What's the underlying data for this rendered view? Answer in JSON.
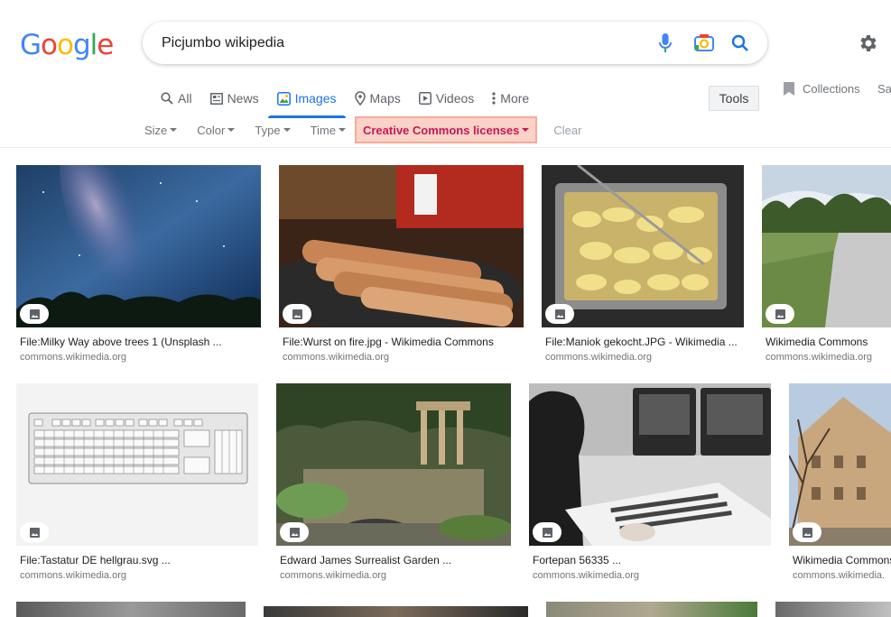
{
  "logo": [
    "G",
    "o",
    "o",
    "g",
    "l",
    "e"
  ],
  "logo_colors": [
    "#4285f4",
    "#ea4335",
    "#fbbc05",
    "#4285f4",
    "#34a853",
    "#ea4335"
  ],
  "search": {
    "query": "Picjumbo wikipedia"
  },
  "tabs": [
    {
      "label": "All",
      "icon": "search-icon"
    },
    {
      "label": "News",
      "icon": "news-icon"
    },
    {
      "label": "Images",
      "icon": "images-icon",
      "active": true
    },
    {
      "label": "Maps",
      "icon": "map-pin-icon"
    },
    {
      "label": "Videos",
      "icon": "video-icon"
    },
    {
      "label": "More",
      "icon": "more-vertical-icon"
    }
  ],
  "tools": "Tools",
  "collections": "Collections",
  "saved": "Sa",
  "filters": [
    "Size",
    "Color",
    "Type",
    "Time"
  ],
  "license_filter": "Creative Commons licenses",
  "clear": "Clear",
  "results": [
    {
      "caption": "File:Milky Way above trees 1 (Unsplash ...",
      "source": "commons.wikimedia.org"
    },
    {
      "caption": "File:Wurst on fire.jpg - Wikimedia Commons",
      "source": "commons.wikimedia.org"
    },
    {
      "caption": "File:Maniok gekocht.JPG - Wikimedia ...",
      "source": "commons.wikimedia.org"
    },
    {
      "caption": "Wikimedia Commons",
      "source": "commons.wikimedia.org"
    },
    {
      "caption": "File:Tastatur DE hellgrau.svg ...",
      "source": "commons.wikimedia.org"
    },
    {
      "caption": "Edward James Surrealist Garden ...",
      "source": "commons.wikimedia.org"
    },
    {
      "caption": "Fortepan 56335 ...",
      "source": "commons.wikimedia.org"
    },
    {
      "caption": "Wikimedia Commons",
      "source": "commons.wikimedia."
    }
  ],
  "colors": {
    "accent": "#1a73e8",
    "highlight_bg": "#fbd3c6",
    "highlight_text": "#c2185b"
  }
}
